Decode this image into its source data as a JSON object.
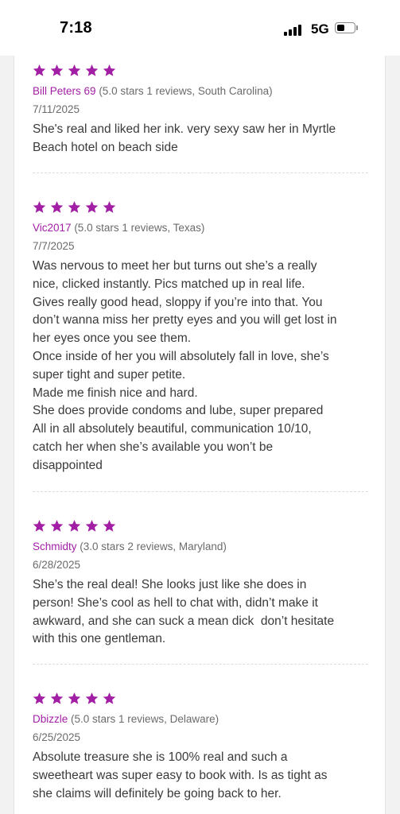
{
  "status_bar": {
    "time": "7:18",
    "network": "5G",
    "signal_bars": 4,
    "battery_level": 0.45
  },
  "colors": {
    "accent": "#a21fa5",
    "text": "#3a3a3a",
    "muted": "#6b6b6b"
  },
  "reviews": [
    {
      "rating": 5,
      "reviewer": "Bill Peters 69",
      "summary": "(5.0 stars 1 reviews, South Carolina)",
      "date": "7/11/2025",
      "body": "She's real and liked her ink. very sexy saw her in Myrtle\nBeach hotel on beach side"
    },
    {
      "rating": 5,
      "reviewer": "Vic2017",
      "summary": "(5.0 stars 1 reviews, Texas)",
      "date": "7/7/2025",
      "body": "Was nervous to meet her but turns out she’s a really\nnice, clicked instantly. Pics matched up in real life.\nGives really good head, sloppy if you’re into that. You\ndon’t wanna miss her pretty eyes and you will get lost in\nher eyes once you see them.\nOnce inside of her you will absolutely fall in love, she’s\nsuper tight and super petite.\nMade me finish nice and hard.\nShe does provide condoms and lube, super prepared\nAll in all absolutely beautiful, communication 10/10,\ncatch her when she’s available you won’t be\ndisappointed"
    },
    {
      "rating": 5,
      "reviewer": "Schmidty",
      "summary": "(3.0 stars 2 reviews, Maryland)",
      "date": "6/28/2025",
      "body": "She’s the real deal! She looks just like she does in\nperson! She’s cool as hell to chat with, didn’t make it\nawkward, and she can suck a mean dick  don’t hesitate\nwith this one gentleman."
    },
    {
      "rating": 5,
      "reviewer": "Dbizzle",
      "summary": "(5.0 stars 1 reviews, Delaware)",
      "date": "6/25/2025",
      "body": "Absolute treasure she is 100% real and such a\nsweetheart was super easy to book with. Is as tight as\nshe claims will definitely be going back to her."
    }
  ]
}
